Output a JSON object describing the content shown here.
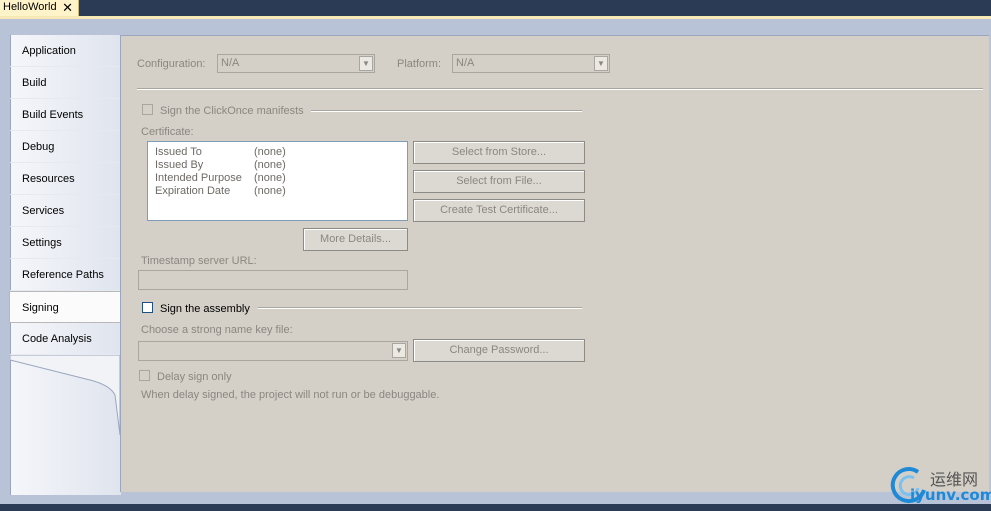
{
  "document_tab": {
    "label": "HelloWorld",
    "close": "✕"
  },
  "nav": {
    "items": [
      {
        "label": "Application"
      },
      {
        "label": "Build"
      },
      {
        "label": "Build Events"
      },
      {
        "label": "Debug"
      },
      {
        "label": "Resources"
      },
      {
        "label": "Services"
      },
      {
        "label": "Settings"
      },
      {
        "label": "Reference Paths"
      },
      {
        "label": "Signing",
        "active": true
      },
      {
        "label": "Code Analysis"
      }
    ]
  },
  "config": {
    "configuration_label": "Configuration:",
    "configuration_value": "N/A",
    "platform_label": "Platform:",
    "platform_value": "N/A"
  },
  "clickonce": {
    "checkbox_label": "Sign the ClickOnce manifests",
    "checked": false,
    "certificate_label": "Certificate:",
    "cert_rows": [
      {
        "key": "Issued To",
        "value": "(none)"
      },
      {
        "key": "Issued By",
        "value": "(none)"
      },
      {
        "key": "Intended Purpose",
        "value": "(none)"
      },
      {
        "key": "Expiration Date",
        "value": "(none)"
      }
    ],
    "select_store": "Select from Store...",
    "select_file": "Select from File...",
    "create_test": "Create Test Certificate...",
    "more_details": "More Details...",
    "timestamp_label": "Timestamp server URL:",
    "timestamp_value": ""
  },
  "assembly": {
    "checkbox_label": "Sign the assembly",
    "checked": false,
    "keyfile_label": "Choose a strong name key file:",
    "keyfile_value": "",
    "change_password": "Change Password...",
    "delay_label": "Delay sign only",
    "delay_checked": false,
    "note": "When delay signed, the project will not run or be debuggable."
  },
  "watermark": {
    "cn": "运维网",
    "url": "iyunv.com"
  },
  "colors": {
    "frame": "#2b3a55",
    "panel": "#d4d0c8",
    "accent": "#1e8ad6"
  }
}
